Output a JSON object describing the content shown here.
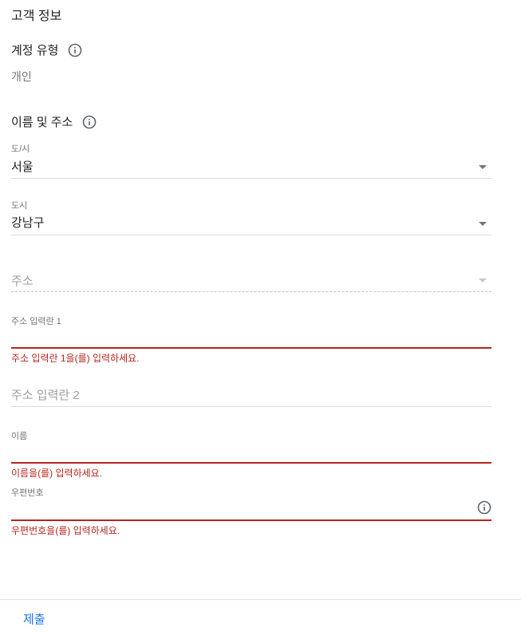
{
  "page": {
    "title": "고객 정보"
  },
  "account_type": {
    "label": "계정 유형",
    "value": "개인",
    "icon": "info-icon"
  },
  "name_address": {
    "label": "이름 및 주소",
    "icon": "info-icon"
  },
  "fields": {
    "province": {
      "label": "도/시",
      "value": "서울"
    },
    "city": {
      "label": "도시",
      "value": "강남구"
    },
    "address": {
      "placeholder": "주소"
    },
    "address_line1": {
      "label": "주소 입력란 1",
      "error": "주소 입력란 1을(를) 입력하세요."
    },
    "address_line2": {
      "placeholder": "주소 입력란 2"
    },
    "name": {
      "label": "이름",
      "error": "이름을(를) 입력하세요."
    },
    "postal_code": {
      "label": "우편번호",
      "error": "우편번호을(를) 입력하세요.",
      "icon": "info-icon"
    }
  },
  "footer": {
    "submit_label": "제출"
  },
  "colors": {
    "error": "#b3261e",
    "accent": "#1a73e8"
  }
}
